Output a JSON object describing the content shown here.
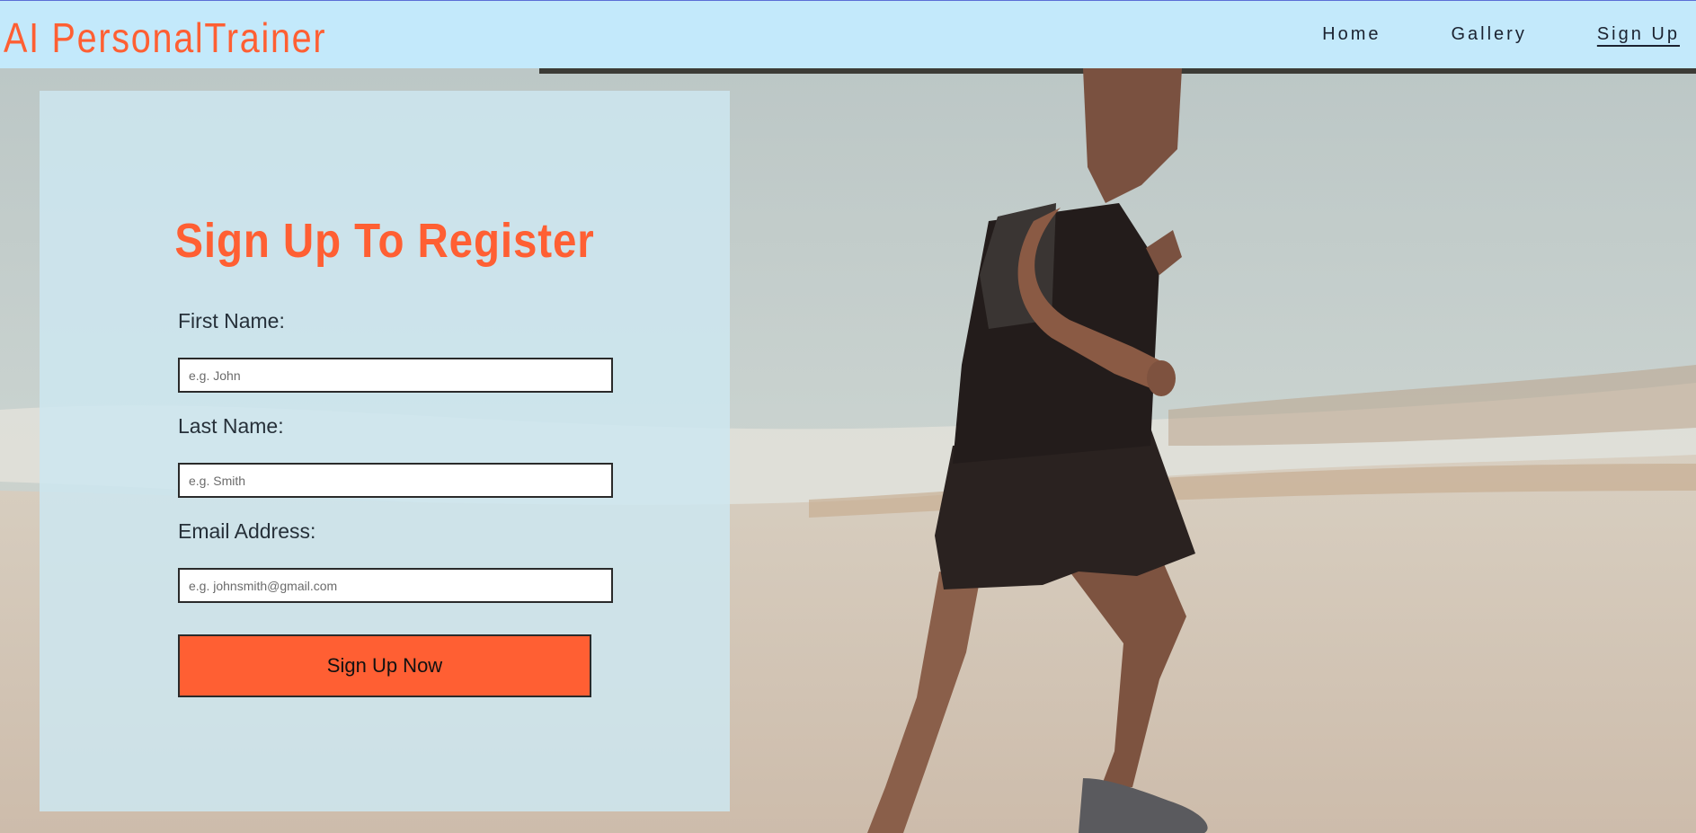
{
  "header": {
    "brand": "AI PersonalTrainer",
    "nav": [
      {
        "label": "Home",
        "active": false
      },
      {
        "label": "Gallery",
        "active": false
      },
      {
        "label": "Sign Up",
        "active": true
      }
    ]
  },
  "form": {
    "title": "Sign Up To Register",
    "first_name": {
      "label": "First Name:",
      "placeholder": "e.g. John",
      "value": ""
    },
    "last_name": {
      "label": "Last Name:",
      "placeholder": "e.g. Smith",
      "value": ""
    },
    "email": {
      "label": "Email Address:",
      "placeholder": "e.g. johnsmith@gmail.com",
      "value": ""
    },
    "submit_label": "Sign Up Now"
  },
  "colors": {
    "accent": "#ff5f33",
    "header_bg": "#c3e9fb",
    "panel_bg": "#cde7f0"
  }
}
